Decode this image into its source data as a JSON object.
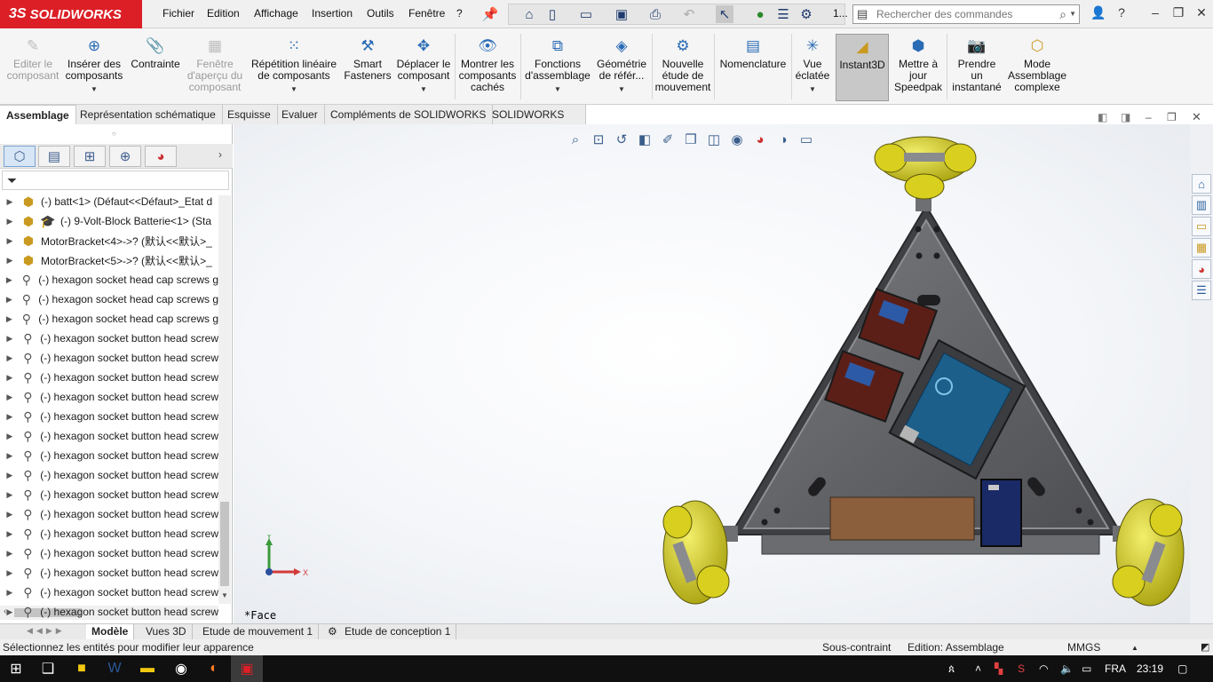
{
  "app": {
    "logo_text": "SOLIDWORKS",
    "logo_mark": "3S",
    "menus": [
      "Fichier",
      "Edition",
      "Affichage",
      "Insertion",
      "Outils",
      "Fenêtre",
      "?"
    ],
    "pin_icon": "pin-icon",
    "quick_access": [
      "home-icon",
      "new-document-icon",
      "open-icon",
      "save-icon",
      "print-icon",
      "undo-icon",
      "select-icon",
      "rebuild-icon",
      "file-properties-icon",
      "options-icon"
    ],
    "quick_more": "1...",
    "search_placeholder": "Rechercher des commandes",
    "window_controls": [
      "user-icon",
      "help-icon",
      "minimize-icon",
      "restore-icon",
      "close-icon"
    ]
  },
  "commands": [
    {
      "label": "Editer le composant",
      "lines": [
        "Editer le",
        "composant"
      ],
      "enabled": false,
      "icon": "edit-component-icon"
    },
    {
      "label": "Insérer des composants",
      "lines": [
        "Insérer des",
        "composants"
      ],
      "enabled": true,
      "icon": "insert-components-icon",
      "dropdown": true
    },
    {
      "label": "Contrainte",
      "lines": [
        "Contrainte"
      ],
      "enabled": true,
      "icon": "mate-icon"
    },
    {
      "label": "Fenêtre d'aperçu du composant",
      "lines": [
        "Fenêtre",
        "d'aperçu du",
        "composant"
      ],
      "enabled": false,
      "icon": "component-preview-icon"
    },
    {
      "label": "Répétition linéaire de composants",
      "lines": [
        "Répétition linéaire",
        "de composants"
      ],
      "enabled": true,
      "icon": "linear-pattern-icon",
      "dropdown": true
    },
    {
      "label": "Smart Fasteners",
      "lines": [
        "Smart",
        "Fasteners"
      ],
      "enabled": true,
      "icon": "smart-fasteners-icon"
    },
    {
      "label": "Déplacer le composant",
      "lines": [
        "Déplacer le",
        "composant"
      ],
      "enabled": true,
      "icon": "move-component-icon",
      "dropdown": true
    },
    {
      "label": "Montrer les composants cachés",
      "lines": [
        "Montrer les",
        "composants",
        "cachés"
      ],
      "enabled": true,
      "icon": "show-hidden-icon"
    },
    {
      "label": "Fonctions d'assemblage",
      "lines": [
        "Fonctions",
        "d'assemblage"
      ],
      "enabled": true,
      "icon": "assembly-features-icon",
      "dropdown": true
    },
    {
      "label": "Géométrie de référ...",
      "lines": [
        "Géométrie",
        "de référ..."
      ],
      "enabled": true,
      "icon": "reference-geometry-icon",
      "dropdown": true
    },
    {
      "label": "Nouvelle étude de mouvement",
      "lines": [
        "Nouvelle",
        "étude de",
        "mouvement"
      ],
      "enabled": true,
      "icon": "motion-study-icon"
    },
    {
      "label": "Nomenclature",
      "lines": [
        "Nomenclature"
      ],
      "enabled": true,
      "icon": "bom-icon"
    },
    {
      "label": "Vue éclatée",
      "lines": [
        "Vue",
        "éclatée"
      ],
      "enabled": true,
      "icon": "exploded-view-icon",
      "dropdown": true
    },
    {
      "label": "Instant3D",
      "lines": [
        "Instant3D"
      ],
      "enabled": true,
      "icon": "instant3d-icon",
      "active": true
    },
    {
      "label": "Mettre à jour Speedpak",
      "lines": [
        "Mettre à",
        "jour",
        "Speedpak"
      ],
      "enabled": true,
      "icon": "speedpak-icon"
    },
    {
      "label": "Prendre un instantané",
      "lines": [
        "Prendre",
        "un",
        "instantané"
      ],
      "enabled": true,
      "icon": "snapshot-icon"
    },
    {
      "label": "Mode Assemblage complexe",
      "lines": [
        "Mode",
        "Assemblage",
        "complexe"
      ],
      "enabled": true,
      "icon": "large-assembly-icon"
    }
  ],
  "tabs": [
    "Assemblage",
    "Représentation schématique",
    "Esquisse",
    "Evaluer",
    "Compléments de SOLIDWORKS",
    "SOLIDWORKS MBD"
  ],
  "active_tab": "Assemblage",
  "feature_tree": {
    "panel_tabs": [
      "feature-manager-icon",
      "property-manager-icon",
      "configuration-manager-icon",
      "dimxpert-icon",
      "display-manager-icon"
    ],
    "items": [
      {
        "text": "(-) batt<1> (Défaut<<Défaut>_Etat d",
        "type": "part"
      },
      {
        "text": "(-) 9-Volt-Block Batterie<1> (Sta",
        "type": "part-grad"
      },
      {
        "text": "MotorBracket<4>->? (默认<<默认>_",
        "type": "part"
      },
      {
        "text": "MotorBracket<5>->? (默认<<默认>_",
        "type": "part"
      },
      {
        "text": "(-) hexagon socket head cap screws g",
        "type": "screw"
      },
      {
        "text": "(-) hexagon socket head cap screws g",
        "type": "screw"
      },
      {
        "text": "(-) hexagon socket head cap screws g",
        "type": "screw"
      },
      {
        "text": "(-) hexagon socket button head screw",
        "type": "screw"
      },
      {
        "text": "(-) hexagon socket button head screw",
        "type": "screw"
      },
      {
        "text": "(-) hexagon socket button head screw",
        "type": "screw"
      },
      {
        "text": "(-) hexagon socket button head screw",
        "type": "screw"
      },
      {
        "text": "(-) hexagon socket button head screw",
        "type": "screw"
      },
      {
        "text": "(-) hexagon socket button head screw",
        "type": "screw"
      },
      {
        "text": "(-) hexagon socket button head screw",
        "type": "screw"
      },
      {
        "text": "(-) hexagon socket button head screw",
        "type": "screw"
      },
      {
        "text": "(-) hexagon socket button head screw",
        "type": "screw"
      },
      {
        "text": "(-) hexagon socket button head screw",
        "type": "screw"
      },
      {
        "text": "(-) hexagon socket button head screw",
        "type": "screw"
      },
      {
        "text": "(-) hexagon socket button head screw",
        "type": "screw"
      },
      {
        "text": "(-) hexagon socket button head screw",
        "type": "screw"
      },
      {
        "text": "(-) hexagon socket button head screw",
        "type": "screw"
      },
      {
        "text": "(-) hexagon socket button head screw",
        "type": "screw"
      }
    ]
  },
  "viewport": {
    "view_label": "*Face",
    "triad": {
      "x": "X",
      "y": "Y"
    },
    "heads_up": [
      "zoom-to-fit-icon",
      "zoom-area-icon",
      "previous-view-icon",
      "section-view-icon",
      "dynamic-annotation-icon",
      "view-orientation-icon",
      "display-style-icon",
      "hide-show-icon",
      "edit-appearance-icon",
      "apply-scene-icon",
      "view-settings-icon"
    ],
    "window_controls": [
      "tile-left-icon",
      "tile-right-icon",
      "viewport-minimize-icon",
      "viewport-restore-icon",
      "viewport-close-icon"
    ]
  },
  "task_pane": [
    "solidworks-resources-icon",
    "design-library-icon",
    "file-explorer-icon",
    "view-palette-icon",
    "appearances-icon",
    "custom-properties-icon"
  ],
  "model_tabs": [
    "Modèle",
    "Vues 3D",
    "Etude de mouvement 1",
    "Etude de conception 1"
  ],
  "active_model_tab": "Modèle",
  "status": {
    "message": "Sélectionnez les entités pour modifier leur apparence",
    "constraint": "Sous-contraint",
    "mode": "Edition: Assemblage",
    "units": "MMGS"
  },
  "taskbar": {
    "apps": [
      "start-icon",
      "task-view-icon",
      "sticky-notes-icon",
      "word-icon",
      "file-explorer-taskbar-icon",
      "game-icon",
      "firefox-icon",
      "solidworks-taskbar-icon"
    ],
    "language": "FRA",
    "time": "23:19"
  },
  "colors": {
    "brand_red": "#dc1f26",
    "accent_blue": "#2a6bb5",
    "wheel_yellow": "#d8cf1e",
    "chassis_gray": "#5f5f62"
  }
}
